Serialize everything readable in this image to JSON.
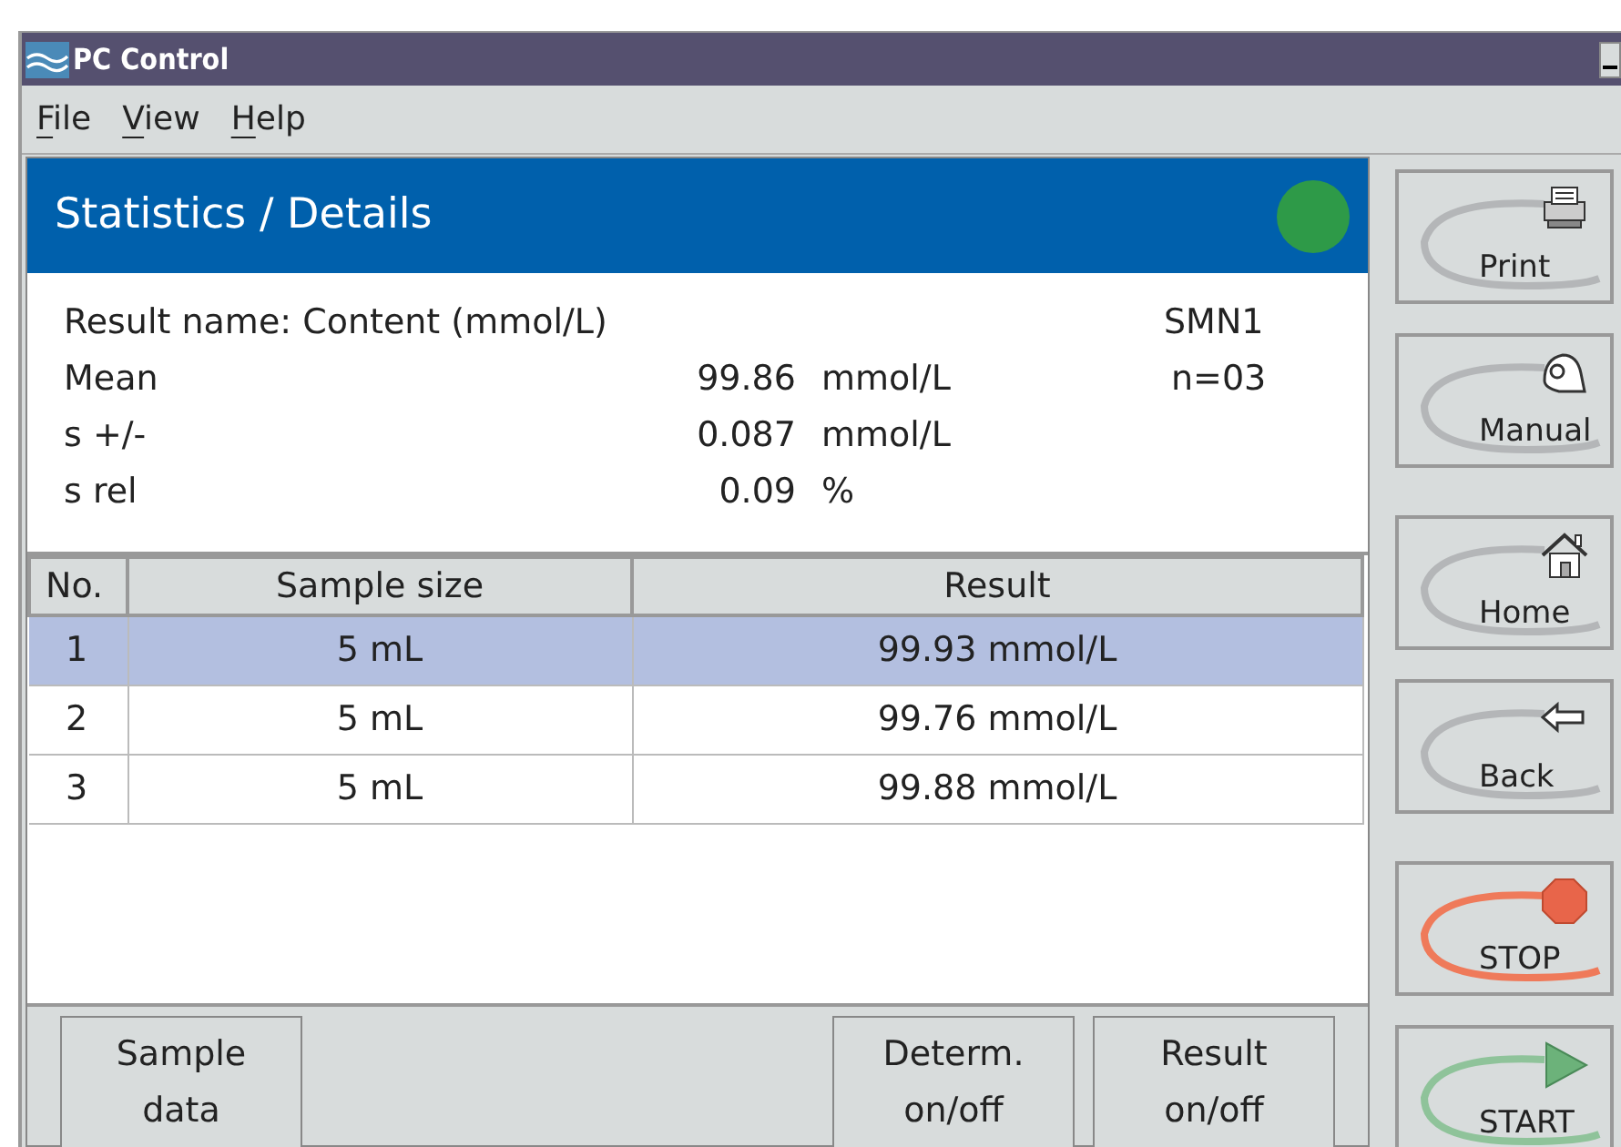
{
  "window": {
    "title": "PC Control"
  },
  "menu": [
    {
      "label": "File"
    },
    {
      "label": "View"
    },
    {
      "label": "Help"
    }
  ],
  "header": {
    "title": "Statistics / Details"
  },
  "stats": {
    "result_name": "Result name: Content (mmol/L)",
    "method": "SMN1",
    "rows": [
      {
        "label": "Mean",
        "value": "99.86",
        "unit": "mmol/L",
        "extra": "n=03"
      },
      {
        "label": "s +/-",
        "value": "0.087",
        "unit": "mmol/L"
      },
      {
        "label": "s rel",
        "value": "0.09",
        "unit": "%"
      }
    ]
  },
  "table": {
    "columns": [
      "No.",
      "Sample size",
      "Result"
    ],
    "rows": [
      {
        "cells": [
          "1",
          "5 mL",
          "99.93 mmol/L"
        ],
        "selected": true
      },
      {
        "cells": [
          "2",
          "5 mL",
          "99.76 mmol/L"
        ],
        "selected": false
      },
      {
        "cells": [
          "3",
          "5 mL",
          "99.88 mmol/L"
        ],
        "selected": false
      }
    ]
  },
  "bottom_buttons": [
    {
      "label": "Sample\ndata",
      "kind": "left"
    },
    {
      "label": "Determ.\non/off",
      "kind": "right"
    },
    {
      "label": "Result\non/off",
      "kind": "right"
    }
  ],
  "side_groups": [
    [
      {
        "label": "Print",
        "kind": "print"
      },
      {
        "label": "Manual",
        "kind": "manual"
      }
    ],
    [
      {
        "label": "Home",
        "kind": "home"
      },
      {
        "label": "Back",
        "kind": "back"
      }
    ],
    [
      {
        "label": "STOP",
        "kind": "stop"
      },
      {
        "label": "START",
        "kind": "start"
      }
    ]
  ]
}
